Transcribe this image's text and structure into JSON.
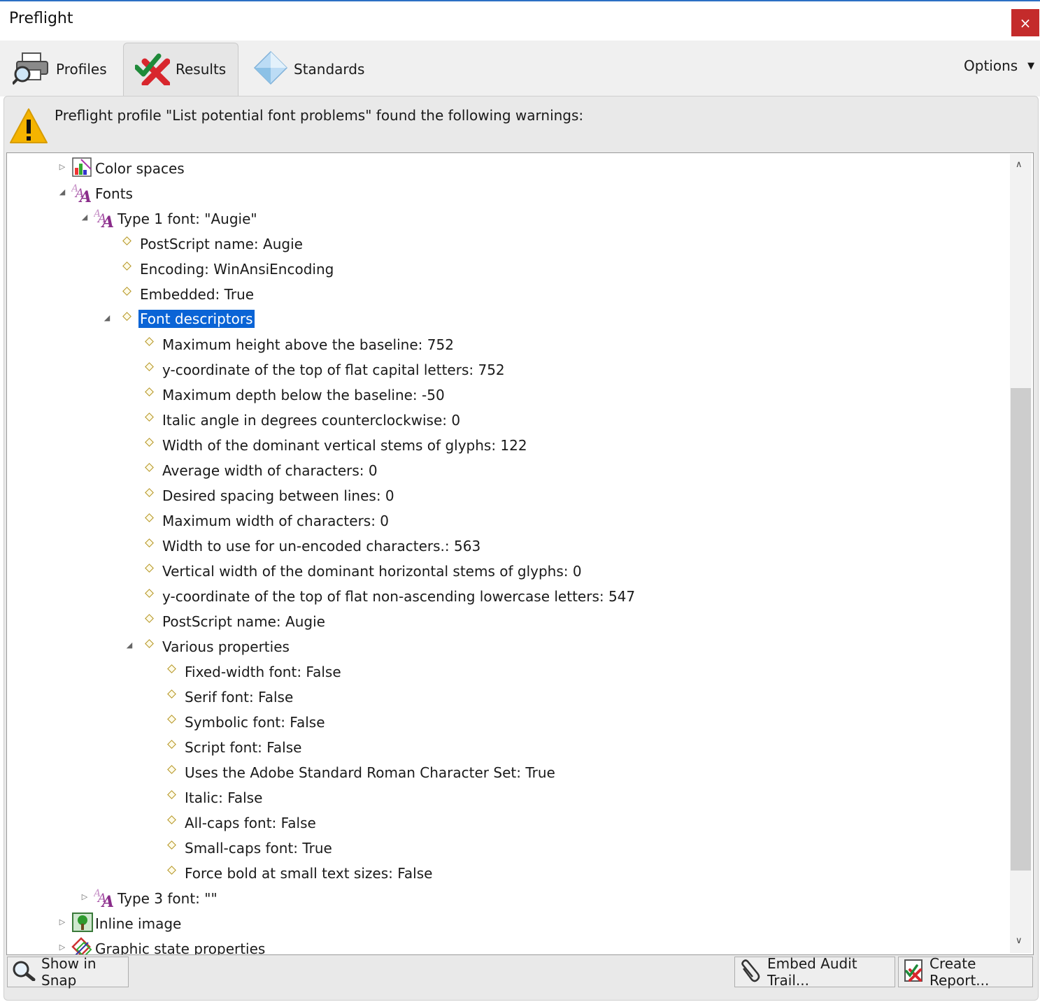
{
  "window": {
    "title": "Preflight",
    "close_label": "×"
  },
  "tabs": [
    {
      "label": "Profiles",
      "icon": "printer-magnifier-icon"
    },
    {
      "label": "Results",
      "icon": "check-cross-icon",
      "selected": true
    },
    {
      "label": "Standards",
      "icon": "diamond-icon"
    }
  ],
  "options": {
    "label": "Options",
    "caret": "▼"
  },
  "warning": {
    "text": "Preflight profile \"List potential font problems\" found the following warnings:",
    "icon": "warning-icon"
  },
  "tree": [
    {
      "text": "Color spaces",
      "toggle": "▷"
    },
    {
      "text": "Fonts",
      "toggle": "◢"
    },
    {
      "text": "Type 1 font: \"Augie\"",
      "toggle": "◢"
    },
    {
      "text": "PostScript name: Augie"
    },
    {
      "text": "Encoding: WinAnsiEncoding"
    },
    {
      "text": "Embedded: True"
    },
    {
      "text": "Font descriptors",
      "toggle": "◢",
      "selected": true
    },
    {
      "text": "Maximum height above the baseline: 752"
    },
    {
      "text": "y-coordinate of the top of flat capital letters: 752"
    },
    {
      "text": "Maximum depth below the baseline: -50"
    },
    {
      "text": "Italic angle in degrees counterclockwise: 0"
    },
    {
      "text": "Width of the dominant vertical stems of glyphs: 122"
    },
    {
      "text": "Average width of characters: 0"
    },
    {
      "text": "Desired spacing between lines: 0"
    },
    {
      "text": "Maximum width of characters: 0"
    },
    {
      "text": "Width to use for un-encoded characters.: 563"
    },
    {
      "text": "Vertical width of the dominant horizontal stems of glyphs: 0"
    },
    {
      "text": "y-coordinate of the top of flat non-ascending lowercase letters: 547"
    },
    {
      "text": "PostScript name: Augie"
    },
    {
      "text": "Various properties",
      "toggle": "◢"
    },
    {
      "text": "Fixed-width font: False"
    },
    {
      "text": "Serif font: False"
    },
    {
      "text": "Symbolic font: False"
    },
    {
      "text": "Script font: False"
    },
    {
      "text": "Uses the Adobe Standard Roman Character Set: True"
    },
    {
      "text": "Italic: False"
    },
    {
      "text": "All-caps font: False"
    },
    {
      "text": "Small-caps font: True"
    },
    {
      "text": "Force bold at small text sizes: False"
    },
    {
      "text": "Type 3 font: \"\"",
      "toggle": "▷"
    },
    {
      "text": "Inline image",
      "toggle": "▷"
    },
    {
      "text": "Graphic state properties",
      "toggle": "▷"
    }
  ],
  "scrollbar": {
    "up": "∧",
    "down": "∨"
  },
  "buttons": {
    "show_in_snap": "Show in Snap",
    "embed_audit_trail": "Embed Audit Trail...",
    "create_report": "Create Report..."
  },
  "colors": {
    "selection": "#0a64d6",
    "close": "#c42b2b",
    "warning": "#f5b400"
  }
}
